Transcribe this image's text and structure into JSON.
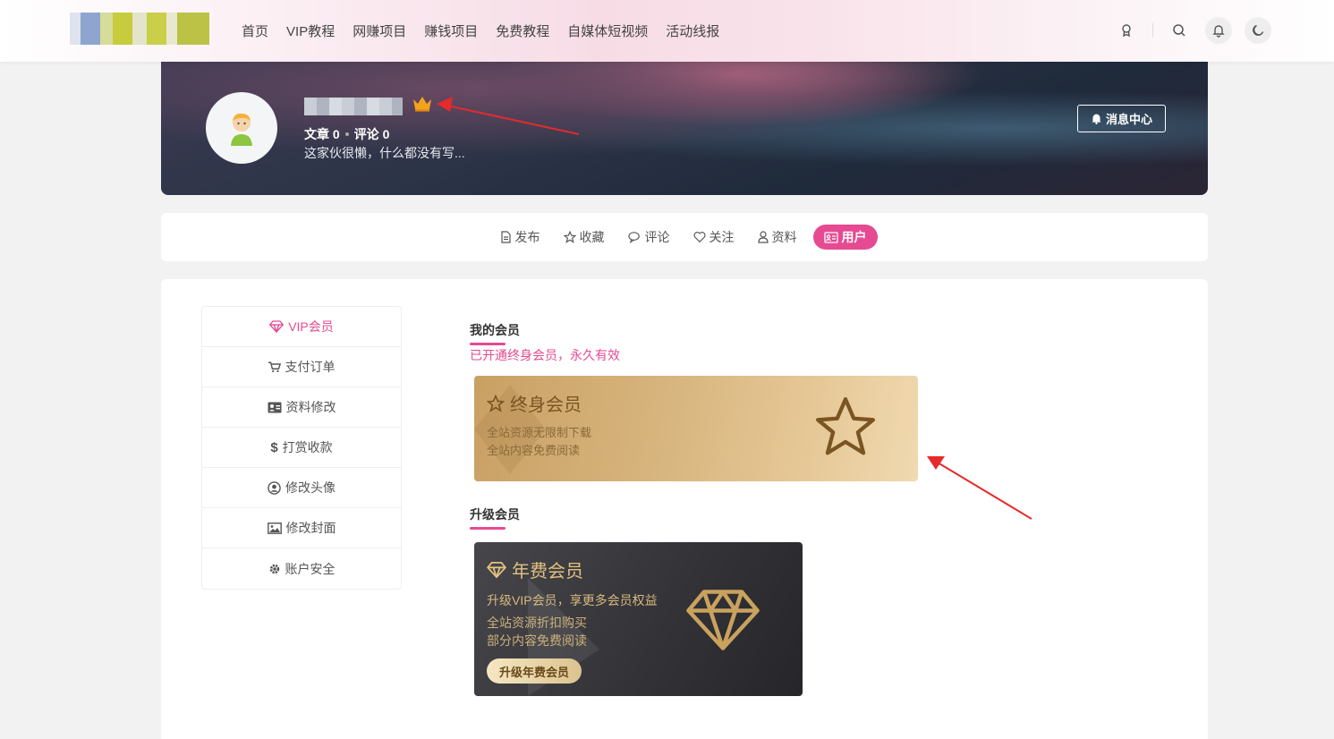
{
  "nav": {
    "links": [
      "首页",
      "VIP教程",
      "网赚项目",
      "赚钱项目",
      "免费教程",
      "自媒体短视频",
      "活动线报"
    ]
  },
  "profile": {
    "stats_articles": "文章 0",
    "stats_comments": "评论 0",
    "bio": "这家伙很懒，什么都没有写...",
    "message_button": "消息中心"
  },
  "tabs": [
    "发布",
    "收藏",
    "评论",
    "关注",
    "资料",
    "用户"
  ],
  "sidebar": {
    "items": [
      "VIP会员",
      "支付订单",
      "资料修改",
      "打赏收款",
      "修改头像",
      "修改封面",
      "账户安全"
    ]
  },
  "membership": {
    "title": "我的会员",
    "status": "已开通终身会员，永久有效",
    "lifetime_card": {
      "title": "终身会员",
      "lines": [
        "全站资源无限制下载",
        "全站内容免费阅读"
      ]
    }
  },
  "upgrade": {
    "title": "升级会员",
    "annual_card": {
      "title": "年费会员",
      "subtitle": "升级VIP会员，享更多会员权益",
      "lines": [
        "全站资源折扣购买",
        "部分内容免费阅读"
      ],
      "button": "升级年费会员"
    }
  },
  "colors": {
    "accent": "#e64a92",
    "gold": "#d8b67f",
    "dark_card": "#333338"
  }
}
